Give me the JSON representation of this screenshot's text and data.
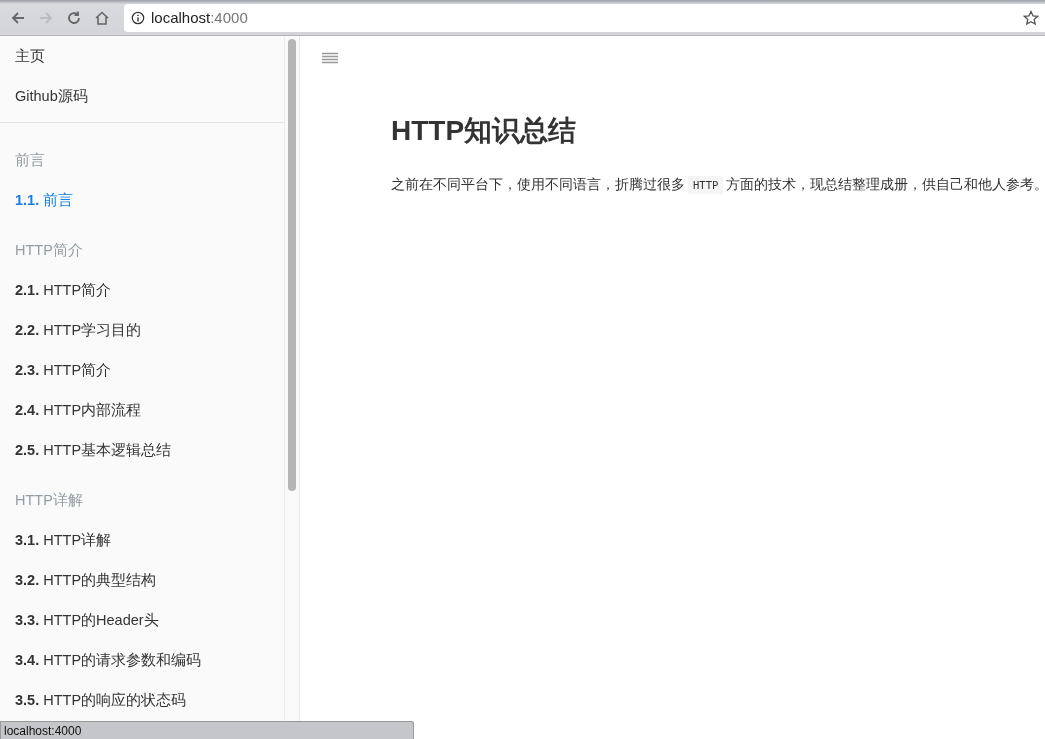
{
  "browser": {
    "url_host": "localhost",
    "url_port": ":4000"
  },
  "sidebar": {
    "items": [
      {
        "kind": "link",
        "label": "主页"
      },
      {
        "kind": "link",
        "label": "Github源码"
      },
      {
        "kind": "divider"
      },
      {
        "kind": "header",
        "label": "前言"
      },
      {
        "kind": "chapter",
        "number": "1.1.",
        "label": "前言",
        "selected": true
      },
      {
        "kind": "header",
        "label": "HTTP简介"
      },
      {
        "kind": "chapter",
        "number": "2.1.",
        "label": "HTTP简介",
        "selected": false
      },
      {
        "kind": "chapter",
        "number": "2.2.",
        "label": "HTTP学习目的",
        "selected": false
      },
      {
        "kind": "chapter",
        "number": "2.3.",
        "label": "HTTP简介",
        "selected": false
      },
      {
        "kind": "chapter",
        "number": "2.4.",
        "label": "HTTP内部流程",
        "selected": false
      },
      {
        "kind": "chapter",
        "number": "2.5.",
        "label": "HTTP基本逻辑总结",
        "selected": false
      },
      {
        "kind": "header",
        "label": "HTTP详解"
      },
      {
        "kind": "chapter",
        "number": "3.1.",
        "label": "HTTP详解",
        "selected": false
      },
      {
        "kind": "chapter",
        "number": "3.2.",
        "label": "HTTP的典型结构",
        "selected": false
      },
      {
        "kind": "chapter",
        "number": "3.3.",
        "label": "HTTP的Header头",
        "selected": false
      },
      {
        "kind": "chapter",
        "number": "3.4.",
        "label": "HTTP的请求参数和编码",
        "selected": false
      },
      {
        "kind": "chapter",
        "number": "3.5.",
        "label": "HTTP的响应的状态码",
        "selected": false
      }
    ]
  },
  "page": {
    "title": "HTTP知识总结",
    "intro_before": "之前在不同平台下，使用不同语言，折腾过很多",
    "intro_code": "HTTP",
    "intro_after": "方面的技术，现总结整理成册，供自己和他人参考。"
  },
  "status_bar": "localhost:4000"
}
